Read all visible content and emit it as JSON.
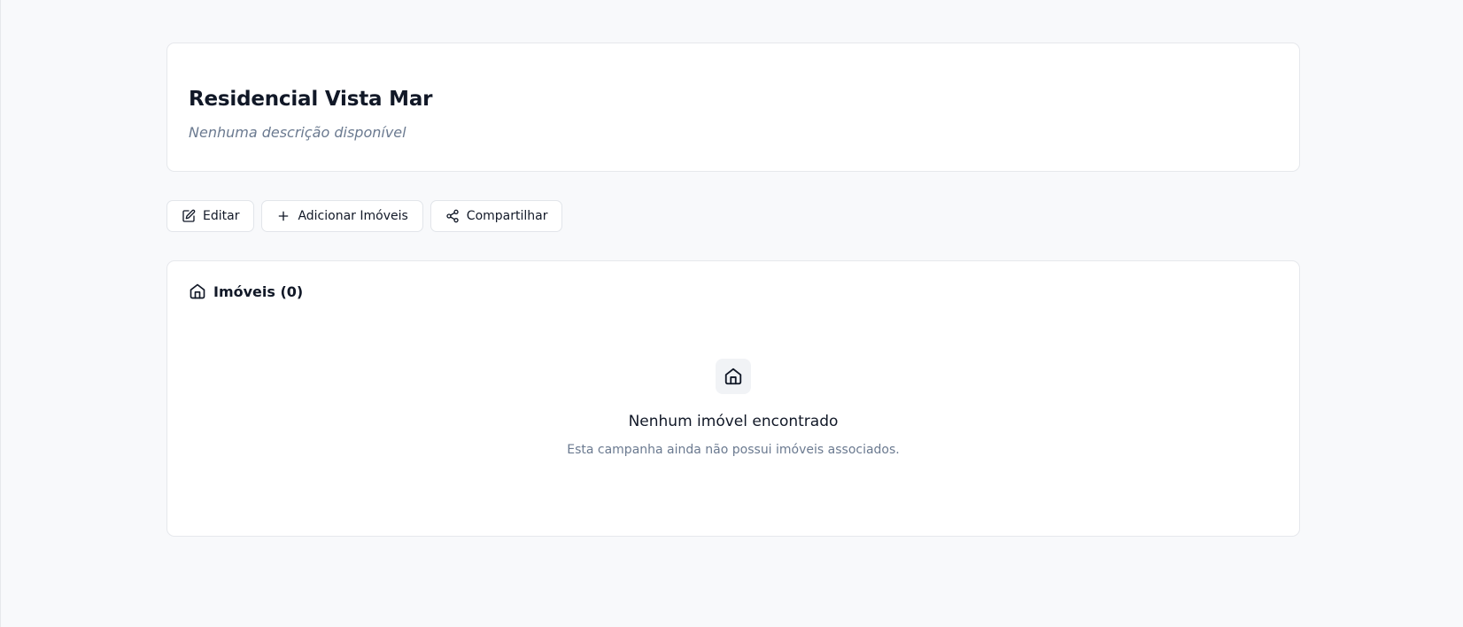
{
  "campaign": {
    "title": "Residencial Vista Mar",
    "description": "Nenhuma descrição disponível"
  },
  "actions": {
    "edit_label": "Editar",
    "add_properties_label": "Adicionar Imóveis",
    "share_label": "Compartilhar"
  },
  "properties": {
    "title": "Imóveis (0)",
    "empty_title": "Nenhum imóvel encontrado",
    "empty_subtitle": "Esta campanha ainda não possui imóveis associados."
  },
  "icons": {
    "edit": "edit-icon",
    "add": "plus-icon",
    "share": "share-icon",
    "section": "house-icon",
    "empty": "house-icon"
  }
}
